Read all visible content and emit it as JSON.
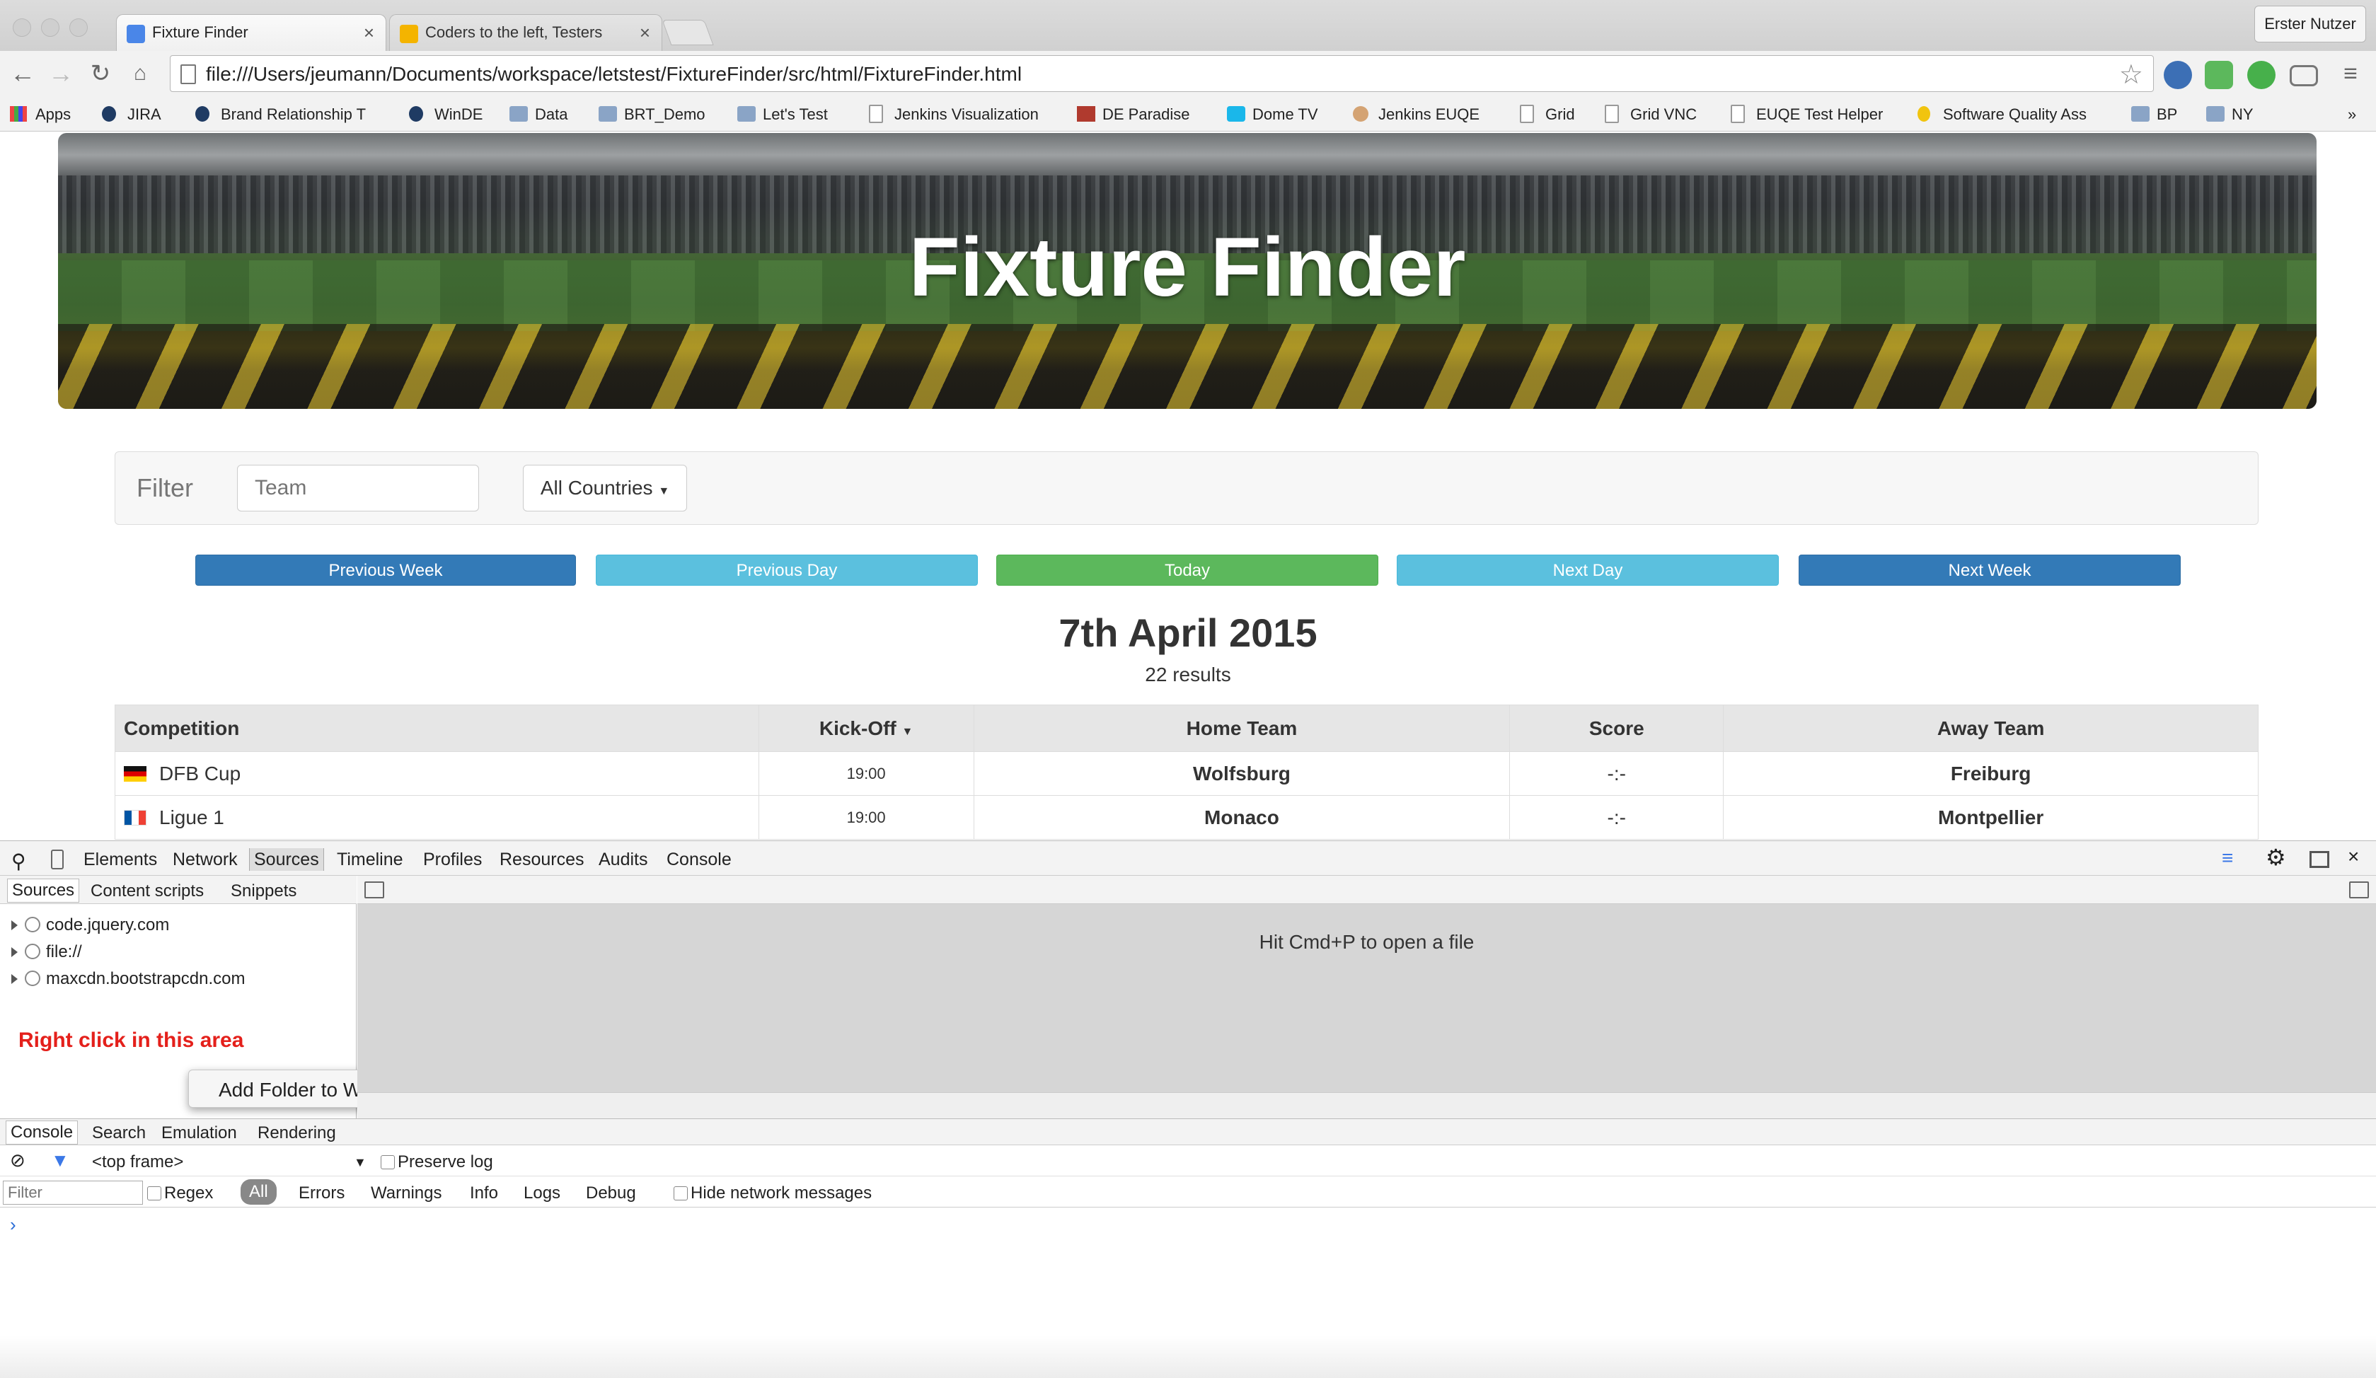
{
  "browser": {
    "tabs": [
      {
        "title": "Fixture Finder",
        "icon": "google-favicon-icon"
      },
      {
        "title": "Coders to the left, Testers",
        "icon": "slides-favicon-icon"
      }
    ],
    "profile_name": "Erster Nutzer",
    "url": "file:///Users/jeumann/Documents/workspace/letstest/FixtureFinder/src/html/FixtureFinder.html",
    "bookmarks": [
      {
        "label": "Apps",
        "icon": "apps-grid-icon"
      },
      {
        "label": "JIRA",
        "icon": "jira-icon"
      },
      {
        "label": "Brand Relationship T",
        "icon": "jira-icon"
      },
      {
        "label": "WinDE",
        "icon": "jira-icon"
      },
      {
        "label": "Data",
        "icon": "folder-icon"
      },
      {
        "label": "BRT_Demo",
        "icon": "folder-icon"
      },
      {
        "label": "Let's Test",
        "icon": "folder-icon"
      },
      {
        "label": "Jenkins Visualization",
        "icon": "page-icon"
      },
      {
        "label": "DE Paradise",
        "icon": "paradise-icon"
      },
      {
        "label": "Dome TV",
        "icon": "vimeo-icon"
      },
      {
        "label": "Jenkins EUQE",
        "icon": "jenkins-icon"
      },
      {
        "label": "Grid",
        "icon": "page-icon"
      },
      {
        "label": "Grid VNC",
        "icon": "page-icon"
      },
      {
        "label": "EUQE Test Helper",
        "icon": "page-icon"
      },
      {
        "label": "Software Quality Ass",
        "icon": "bulb-icon"
      },
      {
        "label": "BP",
        "icon": "folder-icon"
      },
      {
        "label": "NY",
        "icon": "folder-icon"
      }
    ],
    "overflow_label": "»"
  },
  "app": {
    "title": "Fixture Finder",
    "filter_label": "Filter",
    "team_placeholder": "Team",
    "country_select": "All Countries",
    "nav_buttons": {
      "prev_week": "Previous Week",
      "prev_day": "Previous Day",
      "today": "Today",
      "next_day": "Next Day",
      "next_week": "Next Week"
    },
    "date": "7th April 2015",
    "results": "22 results",
    "table": {
      "headers": {
        "competition": "Competition",
        "kickoff": "Kick-Off",
        "home": "Home Team",
        "score": "Score",
        "away": "Away Team"
      },
      "rows": [
        {
          "competition": "DFB Cup",
          "flag": "flag-germany-icon",
          "kickoff": "19:00",
          "home": "Wolfsburg",
          "score": "-:-",
          "away": "Freiburg"
        },
        {
          "competition": "Ligue 1",
          "flag": "flag-france-icon",
          "kickoff": "19:00",
          "home": "Monaco",
          "score": "-:-",
          "away": "Montpellier"
        }
      ]
    }
  },
  "devtools": {
    "tabs": [
      "Elements",
      "Network",
      "Sources",
      "Timeline",
      "Profiles",
      "Resources",
      "Audits",
      "Console"
    ],
    "active_tab": "Sources",
    "sidebar_tabs": [
      "Sources",
      "Content scripts",
      "Snippets"
    ],
    "tree": [
      "code.jquery.com",
      "file://",
      "maxcdn.bootstrapcdn.com"
    ],
    "annotation": "Right click in this area",
    "context_menu_item": "Add Folder to Workspace",
    "open_hint": "Hit Cmd+P to open a file",
    "drawer_tabs": [
      "Console",
      "Search",
      "Emulation",
      "Rendering"
    ],
    "frame": "<top frame>",
    "preserve_log": "Preserve log",
    "filter_placeholder": "Filter",
    "regex": "Regex",
    "levels": [
      "All",
      "Errors",
      "Warnings",
      "Info",
      "Logs",
      "Debug"
    ],
    "hide_network": "Hide network messages",
    "prompt": "›"
  }
}
